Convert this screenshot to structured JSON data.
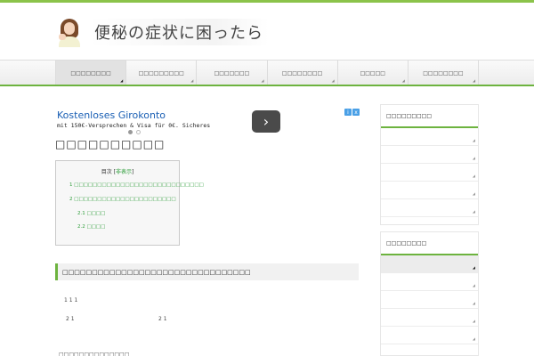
{
  "header": {
    "site_title": "便秘の症状に困ったら"
  },
  "nav": {
    "items": [
      {
        "label": "□□□□□□□□"
      },
      {
        "label": "□□□□□□□□□"
      },
      {
        "label": "□□□□□□□"
      },
      {
        "label": "□□□□□□□□"
      },
      {
        "label": "□□□□□"
      },
      {
        "label": "□□□□□□□□"
      }
    ]
  },
  "ad": {
    "title": "Kostenloses Girokonto",
    "text": "mit 150€-Versprechen & Visa für 0€. Sicheres",
    "next_button": "›",
    "info_icons": [
      "i",
      "x"
    ]
  },
  "article": {
    "title": "□□□□□□□□□□",
    "toc": {
      "heading": "目次",
      "toggle": "非表示",
      "items": [
        "1 □□□□□□□□□□□□□□□□□□□□□□□□□□□□",
        "2 □□□□□□□□□□□□□□□□□□□□□□",
        "2.1 □□□□",
        "2.2 □□□□"
      ]
    },
    "h2": "□□□□□□□□□□□□□□□□□□□□□□□□□□□□□□□□",
    "lines": [
      "1 1 1",
      "2 1",
      "2 1",
      "□□□□□□□□□□□□□□"
    ]
  },
  "sidebar": {
    "box1_title": "□□□□□□□□□",
    "box2_title": "□□□□□□□□"
  },
  "colors": {
    "accent": "#6db33f",
    "link": "#2e9d3a"
  }
}
